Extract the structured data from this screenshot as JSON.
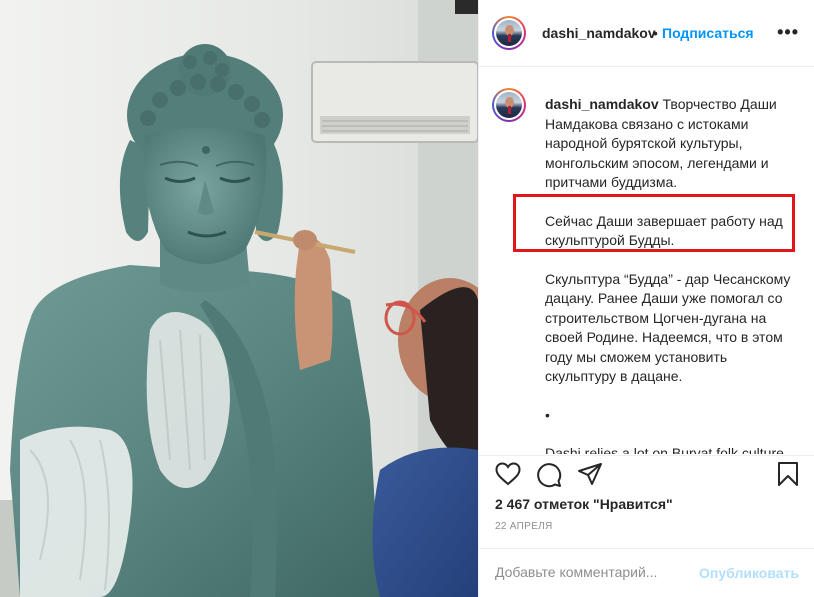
{
  "post": {
    "username": "dashi_namdakov",
    "separator": "•",
    "follow_label": "Подписаться",
    "more_label": "•••",
    "avatar_icon": "profile-avatar"
  },
  "caption": {
    "username": "dashi_namdakov",
    "paragraph_1": "Творчество Даши Намдакова связано с истоками народной бурятской культуры, монгольским эпосом, легендами и притчами буддизма.",
    "paragraph_2": "Сейчас Даши завершает работу над скульптурой Будды.",
    "paragraph_3": "Скульптура “Будда” - дар Чесанскому дацану. Ранее Даши уже помогал со строительством Цогчен-дугана на своей Родине. Надеемся, что в этом году мы сможем установить скульптуру в дацане.",
    "paragraph_4": "•",
    "paragraph_5": "Dashi relies a lot on Buryat folk culture, Mongol epos, legends and parables of Buddhism."
  },
  "actions": {
    "icons": [
      "heart-icon",
      "comment-icon",
      "share-icon",
      "bookmark-icon"
    ],
    "likes_text": "2 467 отметок \"Нравится\"",
    "date_text": "22 АПРЕЛЯ",
    "comment_placeholder": "Добавьте комментарий...",
    "post_label": "Опубликовать"
  },
  "colors": {
    "accent": "#0095f6",
    "highlight_border": "#e2151b",
    "statue": "#5f8a86",
    "post_disabled": "#b2dffc"
  }
}
